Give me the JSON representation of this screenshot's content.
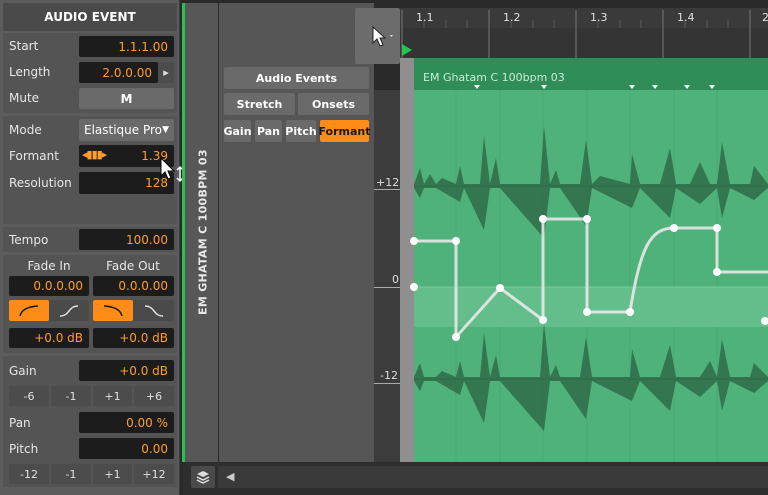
{
  "inspector": {
    "title": "AUDIO EVENT",
    "start": {
      "label": "Start",
      "value": "1.1.1.00"
    },
    "length": {
      "label": "Length",
      "value": "2.0.0.00"
    },
    "mute": {
      "label": "Mute",
      "button": "M"
    },
    "mode": {
      "label": "Mode",
      "value": "Elastique Pro"
    },
    "formant": {
      "label": "Formant",
      "value": "1.39"
    },
    "resolution": {
      "label": "Resolution",
      "value": "128"
    },
    "tempo": {
      "label": "Tempo",
      "value": "100.00"
    },
    "fade_in": {
      "label": "Fade In",
      "value": "0.0.0.00",
      "gain": "+0.0 dB"
    },
    "fade_out": {
      "label": "Fade Out",
      "value": "0.0.0.00",
      "gain": "+0.0 dB"
    },
    "gain": {
      "label": "Gain",
      "value": "+0.0 dB",
      "steps": [
        "-6",
        "-1",
        "+1",
        "+6"
      ]
    },
    "pan": {
      "label": "Pan",
      "value": "0.00 %"
    },
    "pitch": {
      "label": "Pitch",
      "value": "0.00",
      "steps": [
        "-12",
        "-1",
        "+1",
        "+12"
      ]
    }
  },
  "track": {
    "name": "EM GHATAM C 100BPM 03",
    "accent": "#27c24f"
  },
  "clip_panel": {
    "audio_events": "Audio Events",
    "stretch": "Stretch",
    "onsets": "Onsets",
    "tabs": [
      "Gain",
      "Pan",
      "Pitch",
      "Formant"
    ],
    "active_tab": "Formant"
  },
  "ruler": {
    "labels": [
      "1.1",
      "1.2",
      "1.3",
      "1.4",
      "2"
    ]
  },
  "editor": {
    "clip_name": "EM Ghatam C 100bpm 03",
    "scale": [
      "+12",
      "0",
      "-12"
    ],
    "clip_color": "#4fb27a"
  },
  "colors": {
    "accent": "#ff8c16",
    "value": "#ff9e2c"
  }
}
